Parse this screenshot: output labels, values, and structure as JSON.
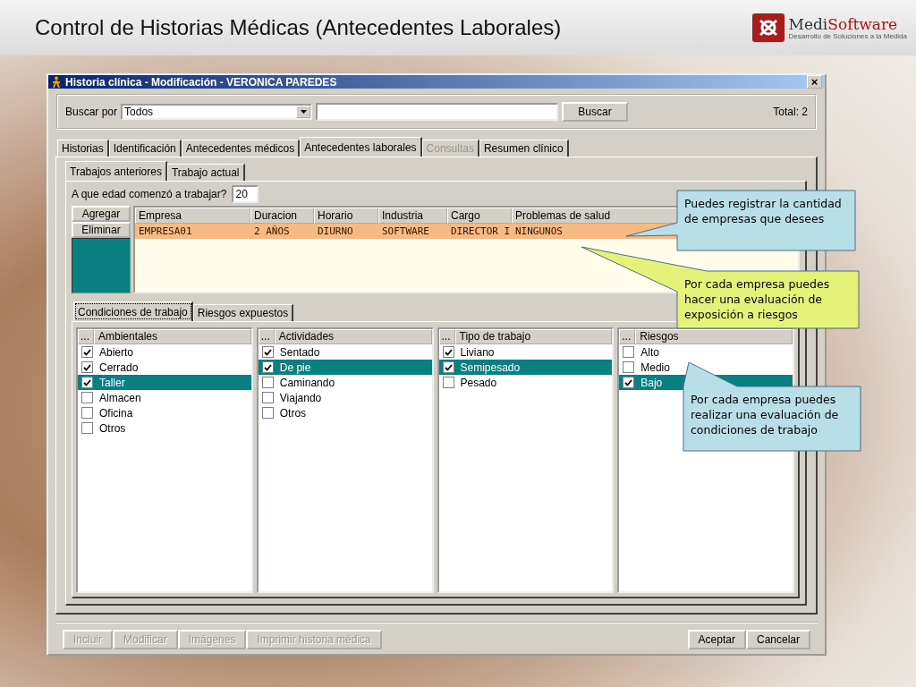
{
  "slide": {
    "title": "Control de Historias Médicas (Antecedentes Laborales)",
    "logo": {
      "name_part_1": "Medi",
      "name_part_2": "Software",
      "tagline": "Desarrollo de Soluciones a la Medida"
    }
  },
  "window": {
    "title": "Historia clínica - Modificación - VERONICA PAREDES",
    "close": "×"
  },
  "search": {
    "label": "Buscar por",
    "filter": "Todos",
    "button": "Buscar",
    "total": "Total: 2"
  },
  "tabs": [
    {
      "label": "Historias",
      "selected": false,
      "disabled": false
    },
    {
      "label": "Identificación",
      "selected": false,
      "disabled": false
    },
    {
      "label": "Antecedentes médicos",
      "selected": false,
      "disabled": false
    },
    {
      "label": "Antecedentes laborales",
      "selected": true,
      "disabled": false
    },
    {
      "label": "Consultas",
      "selected": false,
      "disabled": true
    },
    {
      "label": "Resumen clínico",
      "selected": false,
      "disabled": false
    }
  ],
  "subtabs": [
    {
      "label": "Trabajos anteriores",
      "selected": true
    },
    {
      "label": "Trabajo actual",
      "selected": false
    }
  ],
  "age": {
    "label": "A que edad comenzó a trabajar?",
    "value": "20"
  },
  "side_buttons": [
    "Agregar",
    "Eliminar"
  ],
  "table": {
    "columns": [
      "Empresa",
      "Duracion",
      "Horario",
      "Industria",
      "Cargo",
      "Problemas de salud"
    ],
    "rows": [
      {
        "cells": [
          "EMPRESA01",
          "2 AÑOS",
          "DIURNO",
          "SOFTWARE",
          "DIRECTOR I",
          "NINGUNOS"
        ],
        "selected": true
      }
    ]
  },
  "condition_tabs": [
    {
      "label": "Condiciones de trabajo",
      "selected": true
    },
    {
      "label": "Riesgos expuestos",
      "selected": false
    }
  ],
  "lists": [
    {
      "mark": "...",
      "title": "Ambientales",
      "items": [
        {
          "label": "Abierto",
          "checked": true,
          "selected": false
        },
        {
          "label": "Cerrado",
          "checked": true,
          "selected": false
        },
        {
          "label": "Taller",
          "checked": true,
          "selected": true
        },
        {
          "label": "Almacen",
          "checked": false,
          "selected": false
        },
        {
          "label": "Oficina",
          "checked": false,
          "selected": false
        },
        {
          "label": "Otros",
          "checked": false,
          "selected": false
        }
      ]
    },
    {
      "mark": "...",
      "title": "Actividades",
      "items": [
        {
          "label": "Sentado",
          "checked": true,
          "selected": false
        },
        {
          "label": "De pie",
          "checked": true,
          "selected": true
        },
        {
          "label": "Caminando",
          "checked": false,
          "selected": false
        },
        {
          "label": "Viajando",
          "checked": false,
          "selected": false
        },
        {
          "label": "Otros",
          "checked": false,
          "selected": false
        }
      ]
    },
    {
      "mark": "...",
      "title": "Tipo de trabajo",
      "items": [
        {
          "label": "Liviano",
          "checked": true,
          "selected": false
        },
        {
          "label": "Semipesado",
          "checked": true,
          "selected": true
        },
        {
          "label": "Pesado",
          "checked": false,
          "selected": false
        }
      ]
    },
    {
      "mark": "...",
      "title": "Riesgos",
      "items": [
        {
          "label": "Alto",
          "checked": false,
          "selected": false
        },
        {
          "label": "Medio",
          "checked": false,
          "selected": false
        },
        {
          "label": "Bajo",
          "checked": true,
          "selected": true
        }
      ]
    }
  ],
  "buttons": [
    {
      "label": "Incluir",
      "disabled": true
    },
    {
      "label": "Modificar",
      "disabled": true
    },
    {
      "label": "Imágenes",
      "disabled": true
    },
    {
      "label": "Imprimir historia médica",
      "disabled": true
    },
    {
      "label": "Aceptar",
      "disabled": false
    },
    {
      "label": "Cancelar",
      "disabled": false
    }
  ],
  "callouts": [
    {
      "text": "Puedes registrar la cantidad de empresas que desees",
      "color": "#b8dfe8"
    },
    {
      "text": "Por cada empresa puedes hacer una evaluación de exposición a riesgos",
      "color": "#e4f27a"
    },
    {
      "text": "Por cada empresa puedes realizar una evaluación de condiciones de trabajo",
      "color": "#b8dfe8"
    }
  ]
}
